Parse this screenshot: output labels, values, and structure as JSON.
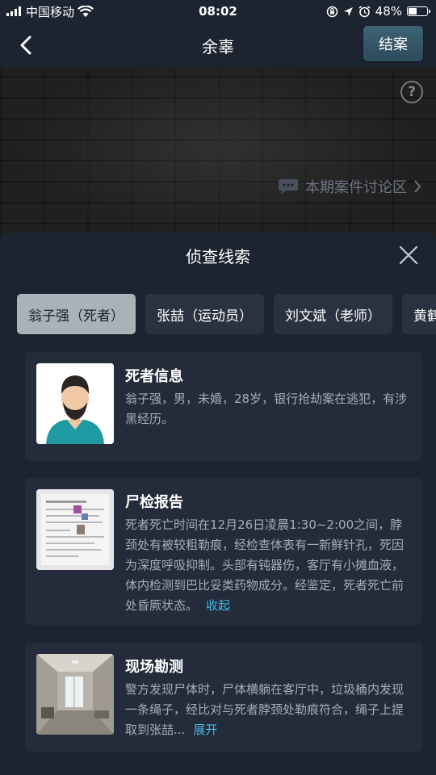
{
  "status_bar": {
    "carrier": "中国移动",
    "time": "08:02",
    "battery_text": "48%",
    "battery_level": 0.48,
    "icons": [
      "signal-icon",
      "wifi-icon",
      "orientation-lock-icon",
      "location-icon",
      "alarm-icon",
      "battery-icon"
    ]
  },
  "nav": {
    "title": "余辜",
    "close_case_label": "结案",
    "back_icon": "chevron-left-icon"
  },
  "banner": {
    "help_label": "?",
    "discussion_label": "本期案件讨论区"
  },
  "panel": {
    "title": "侦查线索",
    "tabs": [
      {
        "label": "翁子强（死者）",
        "active": true
      },
      {
        "label": "张喆（运动员）",
        "active": false
      },
      {
        "label": "刘文斌（老师）",
        "active": false
      },
      {
        "label": "黄鹤铧",
        "active": false
      }
    ],
    "cards": [
      {
        "title": "死者信息",
        "body": "翁子强，男，未婚，28岁，银行抢劫案在逃犯，有涉黑经历。",
        "link": ""
      },
      {
        "title": "尸检报告",
        "body": "死者死亡时间在12月26日凌晨1:30~2:00之间，脖颈处有被较粗勒痕，经检查体表有一新鲜针孔，死因为深度呼吸抑制。头部有钝器伤，客厅有小摊血液，体内检测到巴比妥类药物成分。经鉴定，死者死亡前处昏厥状态。",
        "link": "收起"
      },
      {
        "title": "现场勘测",
        "body": "警方发现尸体时，尸体横躺在客厅中，垃圾桶内发现一条绳子，经比对与死者脖颈处勒痕符合，绳子上提取到张喆...",
        "link": "展开"
      }
    ]
  },
  "colors": {
    "background": "#1c2331",
    "card": "#242b3b",
    "link": "#43b9e8",
    "active_tab": "#aab1b7",
    "close_case_button": "#3a5b6b"
  }
}
